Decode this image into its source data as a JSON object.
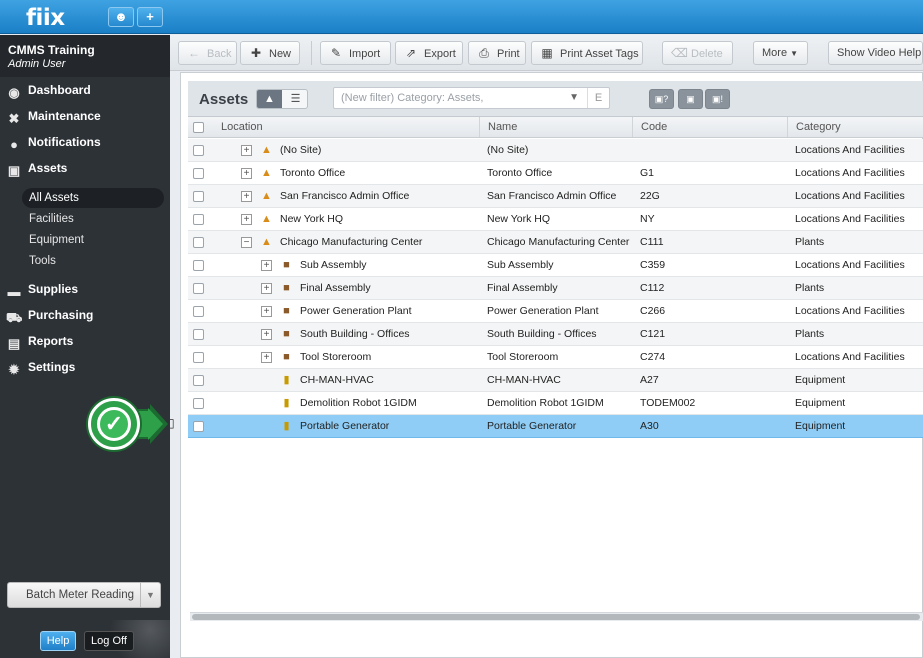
{
  "app": {
    "logo": "fiix"
  },
  "topbar": {
    "user_icon": "user-icon",
    "add_icon": "plus-icon",
    "add_label": "+"
  },
  "user": {
    "org": "CMMS Training",
    "role": "Admin User"
  },
  "sidebar": {
    "items": [
      {
        "label": "Dashboard",
        "icon": "dashboard-icon",
        "glyph": "◉"
      },
      {
        "label": "Maintenance",
        "icon": "tools-icon",
        "glyph": "✖"
      },
      {
        "label": "Notifications",
        "icon": "chat-bubble-icon",
        "glyph": "●"
      },
      {
        "label": "Assets",
        "icon": "box-icon",
        "glyph": "▣"
      },
      {
        "label": "Supplies",
        "icon": "truck-icon",
        "glyph": "▬"
      },
      {
        "label": "Purchasing",
        "icon": "cart-icon",
        "glyph": "⛟"
      },
      {
        "label": "Reports",
        "icon": "chart-icon",
        "glyph": "▤"
      },
      {
        "label": "Settings",
        "icon": "gear-icon",
        "glyph": "✹"
      }
    ],
    "asset_subitems": [
      {
        "label": "All Assets",
        "active": true
      },
      {
        "label": "Facilities"
      },
      {
        "label": "Equipment"
      },
      {
        "label": "Tools"
      }
    ],
    "batch_label": "Batch Meter Reading",
    "help_label": "Help",
    "logoff_label": "Log Off"
  },
  "toolbar": {
    "back": "Back",
    "new": "New",
    "import": "Import",
    "export": "Export",
    "print": "Print",
    "print_tags": "Print Asset Tags",
    "delete": "Delete",
    "more": "More",
    "video_help": "Show Video Help"
  },
  "panel": {
    "title": "Assets",
    "filter_placeholder": "(New filter) Category: Assets,",
    "filter_e": "E",
    "mini_buttons": [
      "?",
      "",
      "!"
    ]
  },
  "table": {
    "columns": [
      "Location",
      "Name",
      "Code",
      "Category"
    ],
    "rows": [
      {
        "location": "(No Site)",
        "name": "(No Site)",
        "code": "",
        "category": "Locations And Facilities",
        "level": 0,
        "toggle": "+",
        "kind": "site"
      },
      {
        "location": "Toronto Office",
        "name": "Toronto Office",
        "code": "G1",
        "category": "Locations And Facilities",
        "level": 0,
        "toggle": "+",
        "kind": "site"
      },
      {
        "location": "San Francisco Admin Office",
        "name": "San Francisco Admin Office",
        "code": "22G",
        "category": "Locations And Facilities",
        "level": 0,
        "toggle": "+",
        "kind": "site"
      },
      {
        "location": "New York HQ",
        "name": "New York HQ",
        "code": "NY",
        "category": "Locations And Facilities",
        "level": 0,
        "toggle": "+",
        "kind": "site"
      },
      {
        "location": "Chicago Manufacturing Center",
        "name": "Chicago Manufacturing Center",
        "code": "C111",
        "category": "Plants",
        "level": 0,
        "toggle": "−",
        "kind": "site"
      },
      {
        "location": "Sub Assembly",
        "name": "Sub Assembly",
        "code": "C359",
        "category": "Locations And Facilities",
        "level": 1,
        "toggle": "+",
        "kind": "bldg"
      },
      {
        "location": "Final Assembly",
        "name": "Final Assembly",
        "code": "C112",
        "category": "Plants",
        "level": 1,
        "toggle": "+",
        "kind": "bldg"
      },
      {
        "location": "Power Generation Plant",
        "name": "Power Generation Plant",
        "code": "C266",
        "category": "Locations And Facilities",
        "level": 1,
        "toggle": "+",
        "kind": "bldg"
      },
      {
        "location": "South Building - Offices",
        "name": "South Building - Offices",
        "code": "C121",
        "category": "Plants",
        "level": 1,
        "toggle": "+",
        "kind": "bldg"
      },
      {
        "location": "Tool Storeroom",
        "name": "Tool Storeroom",
        "code": "C274",
        "category": "Locations And Facilities",
        "level": 1,
        "toggle": "+",
        "kind": "bldg"
      },
      {
        "location": "CH-MAN-HVAC",
        "name": "CH-MAN-HVAC",
        "code": "A27",
        "category": "Equipment",
        "level": 1,
        "toggle": "",
        "kind": "equip"
      },
      {
        "location": "Demolition Robot 1GIDM",
        "name": "Demolition Robot 1GIDM",
        "code": "TODEM002",
        "category": "Equipment",
        "level": 1,
        "toggle": "",
        "kind": "equip"
      },
      {
        "location": "Portable Generator",
        "name": "Portable Generator",
        "code": "A30",
        "category": "Equipment",
        "level": 1,
        "toggle": "",
        "kind": "equip",
        "selected": true
      }
    ]
  },
  "tutorial": {
    "check": "✓"
  }
}
